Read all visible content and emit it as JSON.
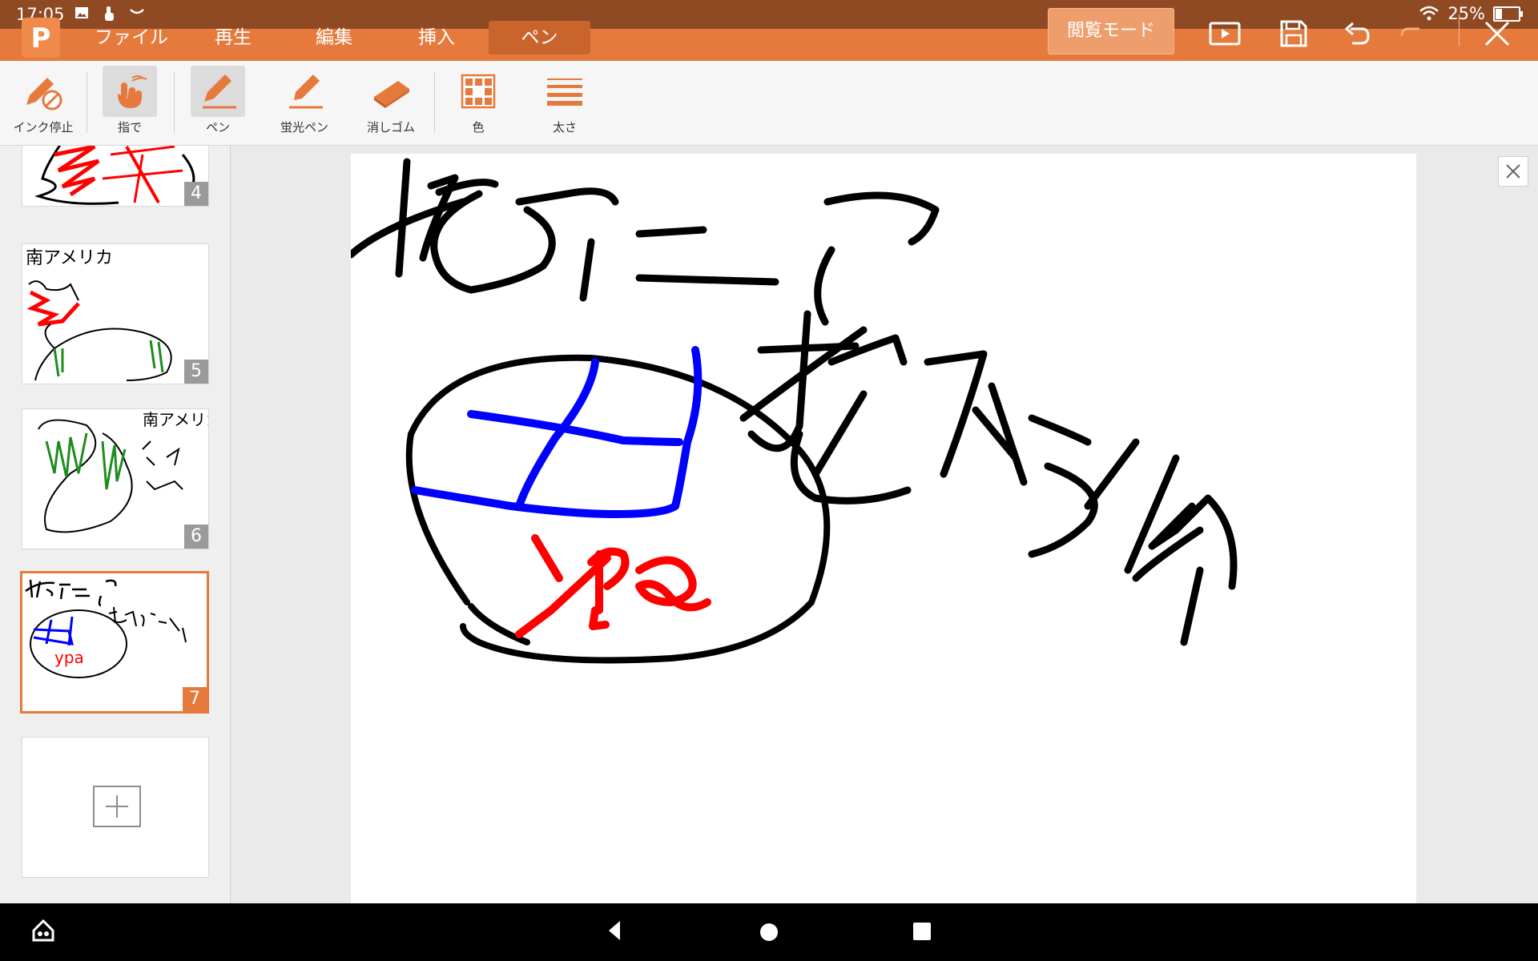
{
  "status_bar": {
    "time": "17:05",
    "battery": "25%"
  },
  "app": {
    "logo": "P",
    "menu": [
      {
        "label": "ファイル"
      },
      {
        "label": "再生"
      },
      {
        "label": "編集"
      },
      {
        "label": "挿入"
      },
      {
        "label": "ペン",
        "active": true
      }
    ],
    "mode_button": "閲覧モード"
  },
  "toolbar": {
    "tools": [
      {
        "label": "インク停止",
        "icon": "ink-stop-icon"
      },
      {
        "label": "指で",
        "icon": "finger-touch-icon",
        "selected": true
      },
      {
        "label": "ペン",
        "icon": "pen-icon",
        "selected": true
      },
      {
        "label": "蛍光ペン",
        "icon": "highlighter-icon"
      },
      {
        "label": "消しゴム",
        "icon": "eraser-icon"
      },
      {
        "label": "色",
        "icon": "color-grid-icon"
      },
      {
        "label": "太さ",
        "icon": "line-thickness-icon"
      }
    ]
  },
  "slides": [
    {
      "number": "4"
    },
    {
      "number": "5",
      "text": "南アメリカ"
    },
    {
      "number": "6",
      "text": "南アメリカ"
    },
    {
      "number": "7",
      "selected": true
    }
  ],
  "canvas": {
    "handwriting_top": "南アニア",
    "handwriting_right": "オーストラリア",
    "handwriting_red": "ypa"
  },
  "colors": {
    "accent": "#e57a3c",
    "ink_black": "#000000",
    "ink_blue": "#0000ff",
    "ink_red": "#ff0000",
    "ink_green": "#1e8c1e"
  }
}
